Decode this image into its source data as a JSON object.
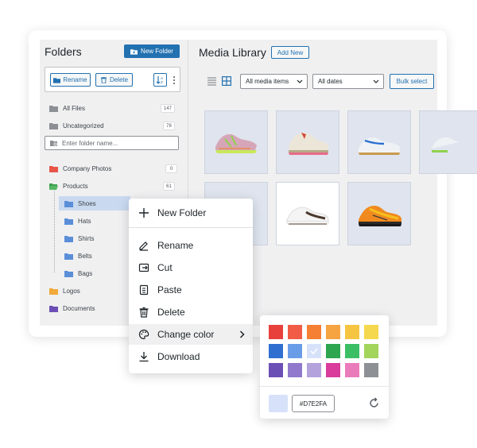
{
  "sidebar": {
    "title": "Folders",
    "new_folder_label": "New Folder",
    "rename_label": "Rename",
    "delete_label": "Delete",
    "all_files": {
      "label": "All Files",
      "count": "147"
    },
    "uncategorized": {
      "label": "Uncategorized",
      "count": "78"
    },
    "search_placeholder": "Enter folder name...",
    "folders": [
      {
        "label": "Company Photos",
        "count": "0",
        "color": "#e8564a"
      },
      {
        "label": "Products",
        "count": "61",
        "color": "#3fa04d"
      },
      {
        "label": "Shoes",
        "color": "#5b8ed8"
      },
      {
        "label": "Hats",
        "color": "#5b8ed8"
      },
      {
        "label": "Shirts",
        "color": "#5b8ed8"
      },
      {
        "label": "Belts",
        "color": "#5b8ed8"
      },
      {
        "label": "Bags",
        "color": "#5b8ed8"
      },
      {
        "label": "Logos",
        "color": "#f0a93a"
      },
      {
        "label": "Documents",
        "color": "#6c4fb5"
      }
    ]
  },
  "main": {
    "title": "Media Library",
    "add_new_label": "Add New",
    "filter_media": "All media items",
    "filter_dates": "All dates",
    "bulk_select_label": "Bulk select"
  },
  "context_menu": {
    "items": [
      {
        "label": "New Folder",
        "icon": "plus-icon"
      },
      {
        "label": "Rename",
        "icon": "pencil-icon"
      },
      {
        "label": "Cut",
        "icon": "cut-icon"
      },
      {
        "label": "Paste",
        "icon": "clipboard-icon"
      },
      {
        "label": "Delete",
        "icon": "trash-icon"
      },
      {
        "label": "Change color",
        "icon": "palette-icon"
      },
      {
        "label": "Download",
        "icon": "download-icon"
      }
    ]
  },
  "color_picker": {
    "swatches": [
      "#e8403a",
      "#f05c45",
      "#f57f33",
      "#f5a441",
      "#f5c542",
      "#f5d84d",
      "#2f6fd0",
      "#6a9de8",
      "#d7e2fa",
      "#2ea54f",
      "#3cbf64",
      "#a3d45c",
      "#6c4fb5",
      "#9179cc",
      "#b4a2dd",
      "#d93c9a",
      "#ea7bbb",
      "#8d9195"
    ],
    "selected_index": 8,
    "hex_value": "#D7E2FA",
    "preview_color": "#D7E2FA"
  },
  "colors": {
    "accent": "#2271b1"
  }
}
